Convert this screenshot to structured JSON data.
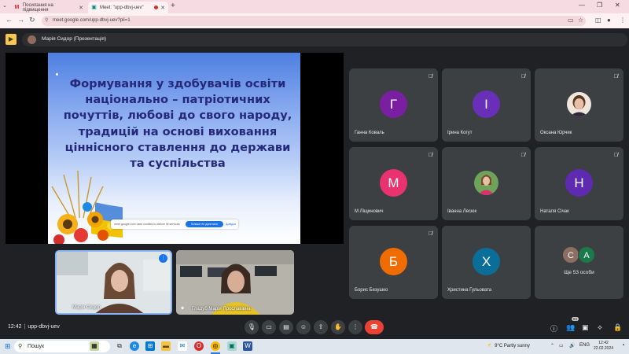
{
  "browser": {
    "tabs": [
      {
        "title": "Посилання на підвищення",
        "favicon": "gmail-icon"
      },
      {
        "title": "Meet: \"upp-dbvj-uev\"",
        "favicon": "meet-icon",
        "recording": true
      }
    ],
    "url": "meet.google.com/upp-dbvj-uev?pli=1"
  },
  "meet": {
    "presenter_label": "Марія Сидор (Презентація)",
    "slide_title": "Формування у здобувачів освіти національно – патріотичних почуттів, любові до свого народу, традицій на основі виховання ціннісного ставлення до держави та суспільства",
    "consent": {
      "text": "meet.google.com uses cookies to deliver its services",
      "button": "Більше не допитися",
      "link": "Довідка"
    },
    "local_tiles": [
      {
        "name": "Марія Сидор"
      },
      {
        "name": "Гладуб Марія Ярославівна"
      }
    ],
    "participants": [
      {
        "name": "Ганна Коваль",
        "initial": "Г",
        "color": "#7b1fa2",
        "muted": true
      },
      {
        "name": "Ірина Когут",
        "initial": "І",
        "color": "#6a2fb8",
        "muted": true
      },
      {
        "name": "Оксана Юрчик",
        "initial": "",
        "photo": true,
        "muted": true
      },
      {
        "name": "М Ліщинович",
        "initial": "М",
        "color": "#e8336f",
        "muted": true
      },
      {
        "name": "Іванна Лесюк",
        "initial": "",
        "photo": true,
        "muted": true
      },
      {
        "name": "Наталя Січак",
        "initial": "Н",
        "color": "#5e2ab2",
        "muted": true
      },
      {
        "name": "Борис Безушко",
        "initial": "Б",
        "color": "#ef6c00",
        "muted": true
      },
      {
        "name": "Христина Гульовата",
        "initial": "Х",
        "color": "#0b6e99",
        "muted": true
      }
    ],
    "more": {
      "initials": [
        "С",
        "А"
      ],
      "colors": [
        "#8d6e63",
        "#1b7a4b"
      ],
      "label": "Ще 53 особи"
    },
    "time": "12:42",
    "meeting_code": "upp-dbvj-uev",
    "people_count": "64"
  },
  "taskbar": {
    "search_placeholder": "Пошук",
    "weather": "9°C  Partly sunny",
    "lang": "ENG",
    "clock_time": "12:42",
    "clock_date": "22.02.2024"
  }
}
